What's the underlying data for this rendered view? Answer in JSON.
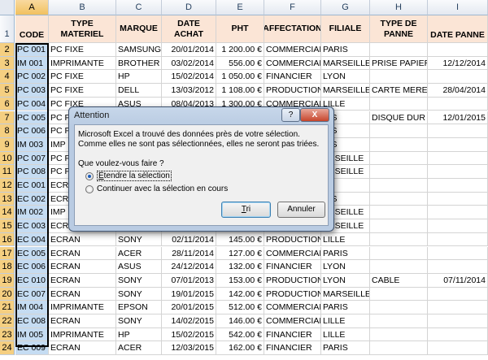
{
  "columns": [
    "A",
    "B",
    "C",
    "D",
    "E",
    "F",
    "G",
    "H",
    "I"
  ],
  "header_row": [
    "CODE",
    "TYPE MATERIEL",
    "MARQUE",
    "DATE ACHAT",
    "PHT",
    "AFFECTATION",
    "FILIALE",
    "TYPE DE PANNE",
    "DATE PANNE"
  ],
  "rows": [
    [
      "PC 001",
      "PC FIXE",
      "SAMSUNG",
      "20/01/2014",
      "1 200.00 €",
      "COMMERCIAL",
      "PARIS",
      "",
      ""
    ],
    [
      "IM 001",
      "IMPRIMANTE",
      "BROTHER",
      "03/02/2014",
      "556.00 €",
      "COMMERCIAL",
      "MARSEILLE",
      "PRISE PAPIER",
      "12/12/2014"
    ],
    [
      "PC 002",
      "PC FIXE",
      "HP",
      "15/02/2014",
      "1 050.00 €",
      "FINANCIER",
      "LYON",
      "",
      ""
    ],
    [
      "PC 003",
      "PC FIXE",
      "DELL",
      "13/03/2012",
      "1 108.00 €",
      "PRODUCTION",
      "MARSEILLE",
      "CARTE MERE",
      "28/04/2014"
    ],
    [
      "PC 004",
      "PC FIXE",
      "ASUS",
      "08/04/2013",
      "1 300.00 €",
      "COMMERCIAL",
      "LILLE",
      "",
      ""
    ],
    [
      "PC 005",
      "PC P",
      "",
      "",
      "",
      "",
      "RIS",
      "DISQUE DUR",
      "12/01/2015"
    ],
    [
      "PC 006",
      "PC P",
      "",
      "",
      "",
      "",
      "RIS",
      "",
      ""
    ],
    [
      "IM 003",
      "IMP",
      "",
      "",
      "",
      "",
      "RIS",
      "",
      ""
    ],
    [
      "PC 007",
      "PC P",
      "",
      "",
      "",
      "",
      "ARSEILLE",
      "",
      ""
    ],
    [
      "PC 008",
      "PC P",
      "",
      "",
      "",
      "",
      "ARSEILLE",
      "",
      ""
    ],
    [
      "EC 001",
      "ECRA",
      "",
      "",
      "",
      "",
      "",
      "",
      ""
    ],
    [
      "EC 002",
      "ECRA",
      "",
      "",
      "",
      "",
      "RIS",
      "",
      ""
    ],
    [
      "IM 002",
      "IMP",
      "",
      "",
      "",
      "",
      "ARSEILLE",
      "",
      ""
    ],
    [
      "EC 003",
      "ECRA",
      "",
      "",
      "",
      "",
      "ARSEILLE",
      "",
      ""
    ],
    [
      "EC 004",
      "ECRAN",
      "SONY",
      "02/11/2014",
      "145.00 €",
      "PRODUCTION",
      "LILLE",
      "",
      ""
    ],
    [
      "EC 005",
      "ECRAN",
      "ACER",
      "28/11/2014",
      "127.00 €",
      "COMMERCIAL",
      "PARIS",
      "",
      ""
    ],
    [
      "EC 006",
      "ECRAN",
      "ASUS",
      "24/12/2014",
      "132.00 €",
      "FINANCIER",
      "LYON",
      "",
      ""
    ],
    [
      "EC 010",
      "ECRAN",
      "SONY",
      "07/01/2013",
      "153.00 €",
      "PRODUCTION",
      "LYON",
      "CABLE",
      "07/11/2014"
    ],
    [
      "EC 007",
      "ECRAN",
      "SONY",
      "19/01/2015",
      "142.00 €",
      "PRODUCTION",
      "MARSEILLE",
      "",
      ""
    ],
    [
      "IM 004",
      "IMPRIMANTE",
      "EPSON",
      "20/01/2015",
      "512.00 €",
      "COMMERCIAL",
      "PARIS",
      "",
      ""
    ],
    [
      "EC 008",
      "ECRAN",
      "SONY",
      "14/02/2015",
      "146.00 €",
      "COMMERCIAL",
      "LILLE",
      "",
      ""
    ],
    [
      "IM 005",
      "IMPRIMANTE",
      "HP",
      "15/02/2015",
      "542.00 €",
      "FINANCIER",
      "LILLE",
      "",
      ""
    ],
    [
      "EC 009",
      "ECRAN",
      "ACER",
      "12/03/2015",
      "162.00 €",
      "FINANCIER",
      "PARIS",
      "",
      ""
    ]
  ],
  "dialog": {
    "title": "Attention",
    "help": "?",
    "close": "X",
    "message": "Microsoft Excel a trouvé des données près de votre sélection. Comme elles ne sont pas sélectionnées, elles ne seront pas triées.",
    "question": "Que voulez-vous faire ?",
    "option1": "Étendre la sélection",
    "option2": "Continuer avec la sélection en cours",
    "option1_selected": true,
    "sort_button": "Tri",
    "cancel_button": "Annuler"
  },
  "colors": {
    "header_fill": "#fbe5d6",
    "selection_fill": "#c5dcf2"
  }
}
